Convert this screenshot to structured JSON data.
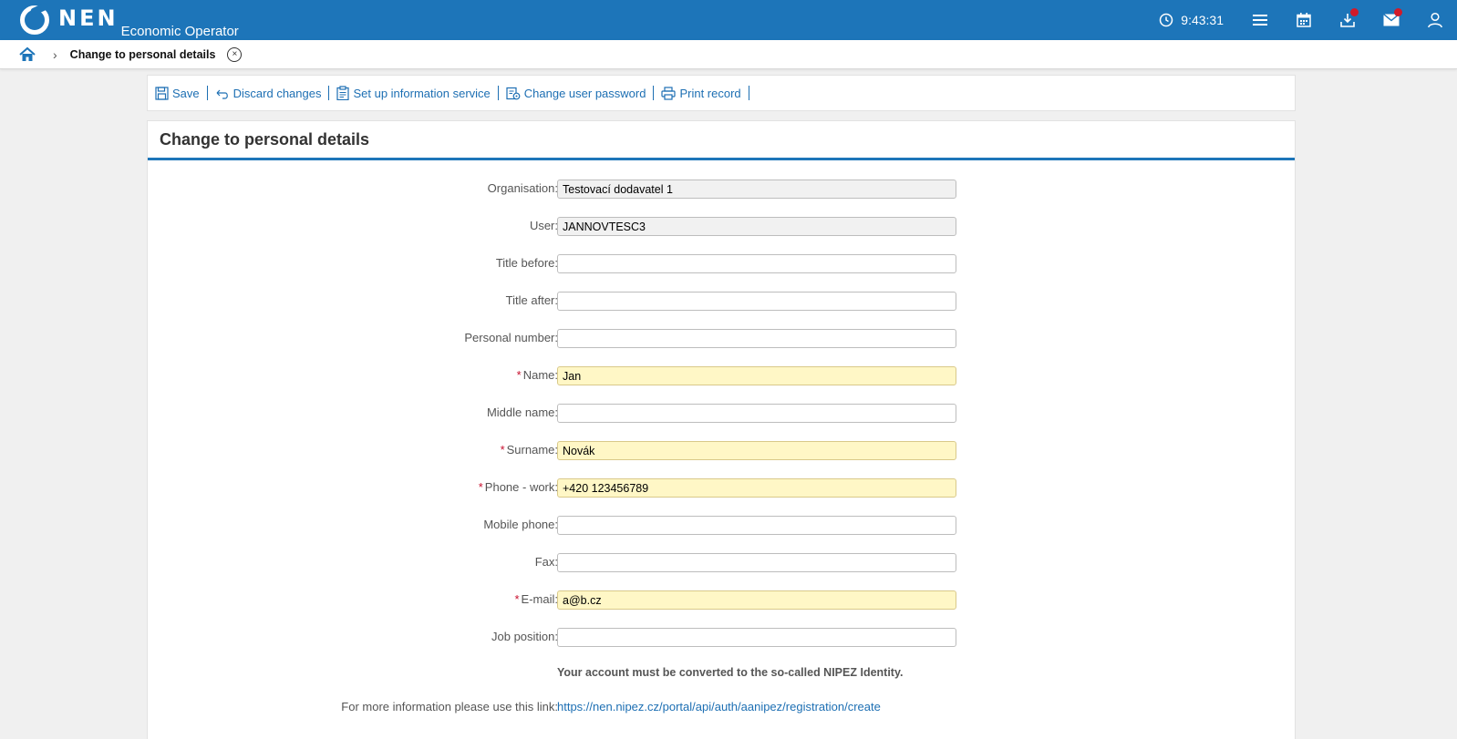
{
  "app": {
    "logo_text": "NEN",
    "subtitle": "Economic Operator"
  },
  "header": {
    "time": "9:43:31",
    "icons": [
      "clock-icon",
      "menu-icon",
      "calendar-icon",
      "download-icon",
      "mail-icon",
      "user-icon"
    ]
  },
  "breadcrumb": {
    "current": "Change to personal details",
    "close_glyph": "×",
    "chevron_glyph": "›"
  },
  "toolbar": {
    "save": "Save",
    "discard": "Discard changes",
    "info_service": "Set up information service",
    "change_password": "Change user password",
    "print": "Print record"
  },
  "form": {
    "title": "Change to personal details",
    "required_mark": "*",
    "fields": [
      {
        "label": "Organisation:",
        "value": "Testovací dodavatel 1",
        "state": "readonly"
      },
      {
        "label": "User:",
        "value": "JANNOVTESC3",
        "state": "readonly"
      },
      {
        "label": "Title before:",
        "value": "",
        "state": "normal"
      },
      {
        "label": "Title after:",
        "value": "",
        "state": "normal"
      },
      {
        "label": "Personal number:",
        "value": "",
        "state": "normal"
      },
      {
        "label": "Name:",
        "value": "Jan",
        "state": "required"
      },
      {
        "label": "Middle name:",
        "value": "",
        "state": "normal"
      },
      {
        "label": "Surname:",
        "value": "Novák",
        "state": "required"
      },
      {
        "label": "Phone - work:",
        "value": "+420 123456789",
        "state": "required"
      },
      {
        "label": "Mobile phone:",
        "value": "",
        "state": "normal"
      },
      {
        "label": "Fax:",
        "value": "",
        "state": "normal"
      },
      {
        "label": "E-mail:",
        "value": "a@b.cz",
        "state": "required"
      },
      {
        "label": "Job position:",
        "value": "",
        "state": "normal"
      }
    ],
    "identity_note": "Your account must be converted to the so-called NIPEZ Identity.",
    "info_label": "For more information please use this link:",
    "info_link": "https://nen.nipez.cz/portal/api/auth/aanipez/registration/create"
  },
  "colors": {
    "brand_blue": "#1d75b9",
    "link_blue": "#1d6fb3",
    "required_bg": "#fff7c6",
    "readonly_bg": "#f1f1f1",
    "required_mark": "#c8102e",
    "notification_dot": "#d11a2a"
  }
}
